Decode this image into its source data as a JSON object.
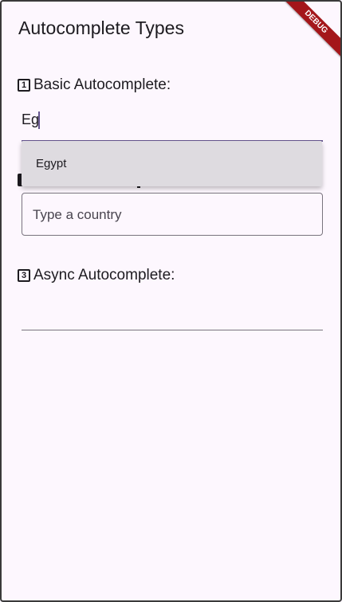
{
  "app_bar": {
    "title": "Autocomplete Types"
  },
  "debug_banner": {
    "label": "DEBUG"
  },
  "sections": {
    "basic": {
      "badge": "1",
      "label": "Basic Autocomplete:"
    },
    "async": {
      "badge": "3",
      "label": "Async Autocomplete:"
    }
  },
  "basic_input": {
    "value": "Eg"
  },
  "dropdown": {
    "options": [
      "Egypt"
    ]
  },
  "country_input": {
    "placeholder": "Type a country"
  },
  "colors": {
    "background": "#fdf7fe",
    "primary": "#65558f",
    "debug": "#a4161a",
    "dropdown_bg": "#dedbe0"
  }
}
